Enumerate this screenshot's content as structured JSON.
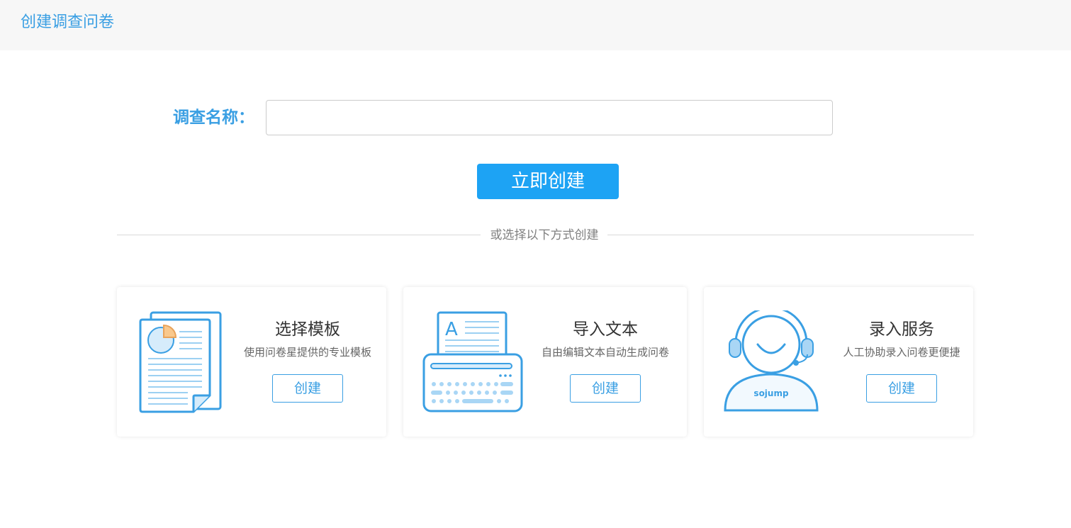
{
  "header": {
    "title": "创建调查问卷"
  },
  "form": {
    "name_label": "调查名称：",
    "name_value": "",
    "name_placeholder": ""
  },
  "create_button": {
    "label": "立即创建"
  },
  "divider": {
    "text": "或选择以下方式创建"
  },
  "cards": [
    {
      "title": "选择模板",
      "desc": "使用问卷星提供的专业模板",
      "button": "创建",
      "icon": "template-document-icon"
    },
    {
      "title": "导入文本",
      "desc": "自由编辑文本自动生成问卷",
      "button": "创建",
      "icon": "typewriter-icon"
    },
    {
      "title": "录入服务",
      "desc": "人工协助录入问卷更便捷",
      "button": "创建",
      "icon": "customer-service-icon"
    }
  ],
  "illustration": {
    "service_brand": "sojump"
  },
  "colors": {
    "accent": "#3a9fe3",
    "primary_button": "#1da3f4",
    "header_bg": "#f7f7f7",
    "icon_fill_light": "#d6ecfb",
    "pie_highlight": "#f9c88c"
  }
}
